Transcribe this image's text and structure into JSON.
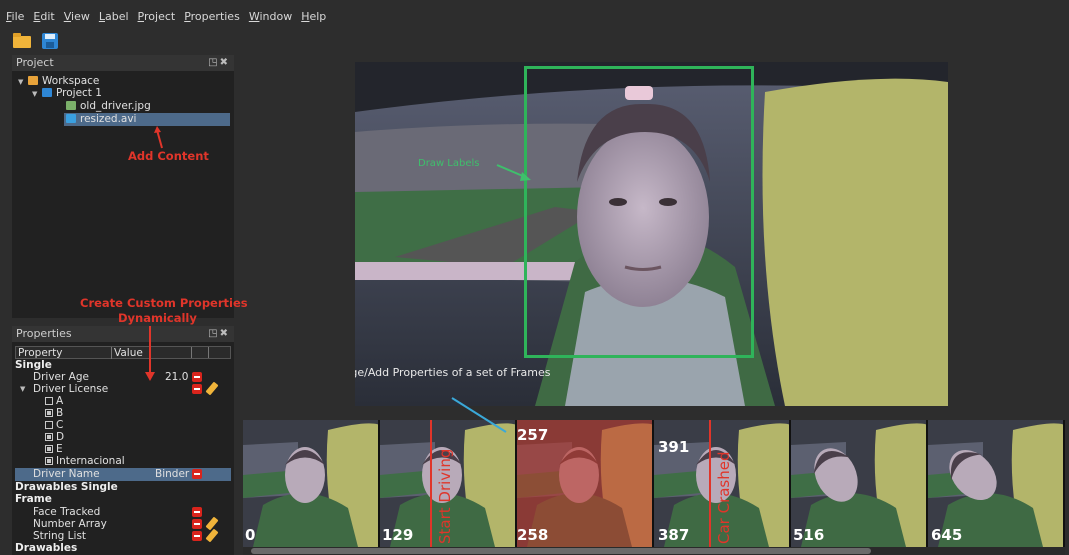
{
  "menu": [
    "File",
    "Edit",
    "View",
    "Label",
    "Project",
    "Properties",
    "Window",
    "Help"
  ],
  "toolbar": {
    "icons": [
      "open-folder-icon",
      "save-disk-icon"
    ]
  },
  "project_panel": {
    "title": "Project",
    "tree": {
      "workspace": "Workspace",
      "project": "Project 1",
      "file1": "old_driver.jpg",
      "file2": "resized.avi"
    },
    "annotation": "Add Content"
  },
  "properties_panel": {
    "title": "Properties",
    "annotation_line1": "Create Custom Properties",
    "annotation_line2": "Dynamically",
    "col_property": "Property",
    "col_value": "Value",
    "section_single": "Single",
    "driver_age_label": "Driver Age",
    "driver_age_value": "21.0",
    "driver_license_label": "Driver License",
    "license_options": [
      {
        "label": "A",
        "checked": false
      },
      {
        "label": "B",
        "checked": true
      },
      {
        "label": "C",
        "checked": false
      },
      {
        "label": "D",
        "checked": true
      },
      {
        "label": "E",
        "checked": true
      },
      {
        "label": "Internacional",
        "checked": true
      }
    ],
    "driver_name_label": "Driver Name",
    "driver_name_value": "Binder",
    "section_drawables_single_1": "Drawables Single",
    "section_drawables_single_2": "Frame",
    "face_tracked": "Face Tracked",
    "number_array": "Number Array",
    "string_list": "String List",
    "section_drawables": "Drawables"
  },
  "viewer": {
    "annotation_draw": "Draw Labels",
    "annotation_change": "Change/Add Properties of a set of Frames"
  },
  "timeline": {
    "frames": [
      {
        "bottom": "0",
        "top": ""
      },
      {
        "bottom": "129",
        "top": ""
      },
      {
        "bottom": "258",
        "top": "257"
      },
      {
        "bottom": "387",
        "top": "391"
      },
      {
        "bottom": "516",
        "top": ""
      },
      {
        "bottom": "645",
        "top": ""
      }
    ],
    "event_start": "Start Driving",
    "event_crash": "Car Crashed"
  },
  "colors": {
    "selection": "#4d6a8a",
    "label_box": "#2fb45a",
    "annotation_red": "#e0352a",
    "highlight_frames": "#c0392b"
  }
}
